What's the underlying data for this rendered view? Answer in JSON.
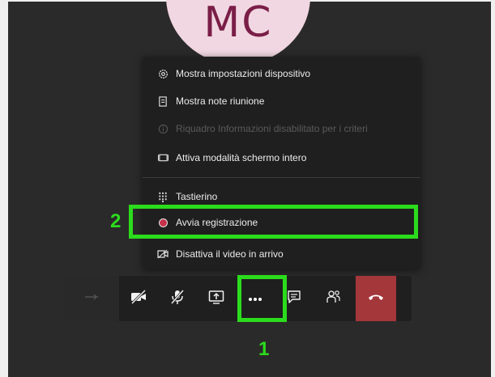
{
  "avatar": {
    "initials": "MC"
  },
  "menu": {
    "items": [
      {
        "label": "Mostra impostazioni dispositivo",
        "icon": "gear-icon",
        "enabled": true
      },
      {
        "label": "Mostra note riunione",
        "icon": "notes-icon",
        "enabled": true
      },
      {
        "label": "Riquadro Informazioni disabilitato per i criteri",
        "icon": "info-icon",
        "enabled": false
      },
      {
        "label": "Attiva modalità schermo intero",
        "icon": "fullscreen-icon",
        "enabled": true
      },
      {
        "label": "Tastierino",
        "icon": "keypad-icon",
        "enabled": true
      },
      {
        "label": "Avvia registrazione",
        "icon": "record-icon",
        "enabled": true
      },
      {
        "label": "Disattiva il video in arrivo",
        "icon": "incoming-video-off-icon",
        "enabled": true
      }
    ]
  },
  "toolbar": {
    "buttons": [
      {
        "name": "share-tray-button",
        "icon": "share-tray-icon"
      },
      {
        "name": "camera-off-button",
        "icon": "camera-off-icon"
      },
      {
        "name": "mic-off-button",
        "icon": "mic-off-icon"
      },
      {
        "name": "share-screen-button",
        "icon": "share-screen-icon"
      },
      {
        "name": "more-actions-button",
        "icon": "ellipsis-icon"
      },
      {
        "name": "chat-button",
        "icon": "chat-icon"
      },
      {
        "name": "participants-button",
        "icon": "participants-icon"
      },
      {
        "name": "hang-up-button",
        "icon": "hang-up-icon"
      }
    ]
  },
  "annotations": {
    "step1": "1",
    "step2": "2",
    "highlight_color": "#2bdc1c"
  },
  "colors": {
    "background": "#2b2a2a",
    "menu": "#1f1f1f",
    "hangup": "#a4373a",
    "record_dot": "#c4314b",
    "avatar_bg": "#f1d7e1",
    "avatar_text": "#7a1e47"
  }
}
